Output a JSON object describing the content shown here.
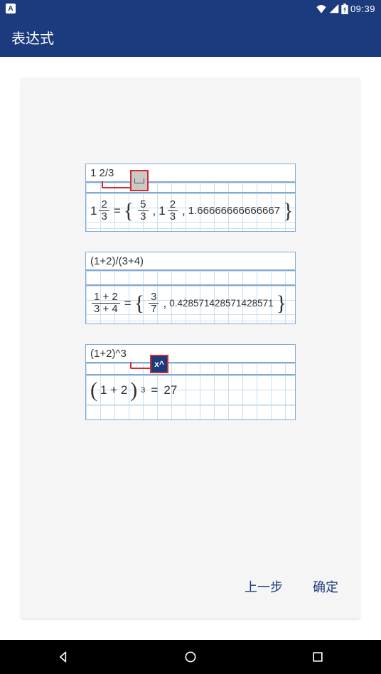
{
  "status_bar": {
    "app_indicator": "A",
    "time": "09:39"
  },
  "app_bar": {
    "title": "表达式"
  },
  "examples": [
    {
      "input": "1 2/3",
      "badge": "space",
      "result_text": "1.66666666666667",
      "mixed_int": "1",
      "frac1_num": "2",
      "frac1_den": "3",
      "frac2_num": "5",
      "frac2_den": "3",
      "mixed2_int": "1",
      "frac3_num": "2",
      "frac3_den": "3"
    },
    {
      "input": "(1+2)/(3+4)",
      "frac_top": "1 + 2",
      "frac_bot": "3 + 4",
      "frac_res_num": "3",
      "frac_res_den": "7",
      "decimal": "0.428571428571428571"
    },
    {
      "input": "(1+2)^3",
      "badge": "x^",
      "base": "1 + 2",
      "exp": "3",
      "result": "27"
    }
  ],
  "buttons": {
    "prev": "上一步",
    "ok": "确定"
  }
}
